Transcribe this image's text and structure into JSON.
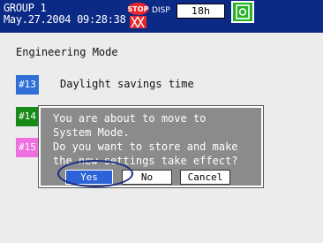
{
  "status_bar": {
    "group": "GROUP 1",
    "datetime": "May.27.2004 09:28:38",
    "stop_label": "STOP",
    "disp_label": "DISP",
    "interval": "18h",
    "memory_icon": "memory-card-icon"
  },
  "main": {
    "title": "Engineering Mode",
    "items": [
      {
        "badge": "#13",
        "label": "Daylight savings time",
        "color": "#2f6fd6"
      },
      {
        "badge": "#14",
        "color": "#178a17"
      },
      {
        "badge": "#15",
        "color": "#ee6fe0"
      }
    ]
  },
  "dialog": {
    "lines": [
      "You are about to move to",
      "System Mode.",
      "Do you want to store and make",
      "the new settings take effect?"
    ],
    "buttons": {
      "yes": "Yes",
      "no": "No",
      "cancel": "Cancel"
    },
    "selected": "Yes"
  },
  "colors": {
    "status_bar_bg": "#0b2a86",
    "dialog_bg": "#8b8b8b",
    "selected_button": "#2c63d8",
    "highlight_ellipse": "#1c2d80"
  }
}
